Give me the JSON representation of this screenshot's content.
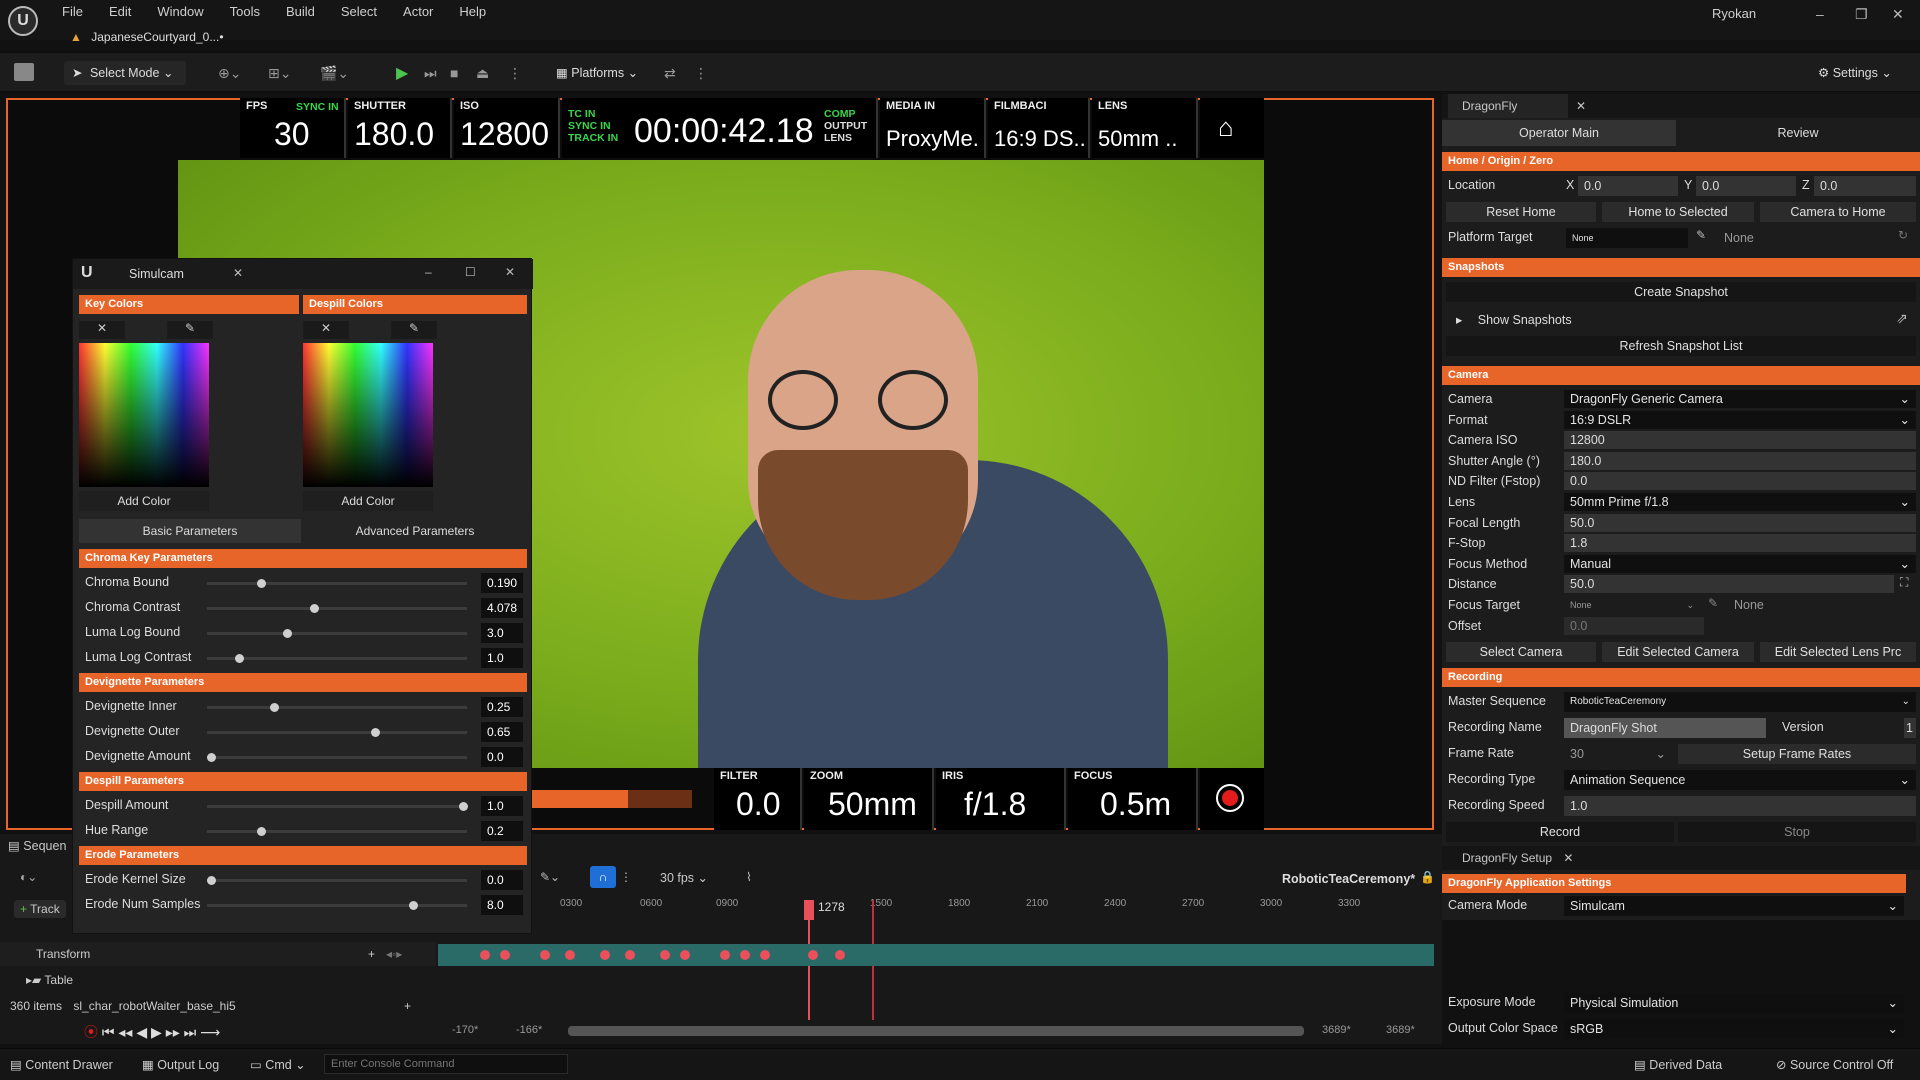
{
  "app": {
    "menu": [
      "File",
      "Edit",
      "Window",
      "Tools",
      "Build",
      "Select",
      "Actor",
      "Help"
    ],
    "document_tab": "JapaneseCourtyard_0...•",
    "user": "Ryokan"
  },
  "toolbar": {
    "select_mode": "Select Mode",
    "platforms": "Platforms",
    "settings": "Settings"
  },
  "hud": {
    "fps_label": "FPS",
    "fps_value": "30",
    "sync_in": "SYNC IN",
    "shutter_label": "SHUTTER",
    "shutter_value": "180.0",
    "iso_label": "ISO",
    "iso_value": "12800",
    "tc_in": "TC IN",
    "tc_sync_in": "SYNC IN",
    "track_in": "TRACK IN",
    "timecode": "00:00:42.18",
    "comp": "COMP",
    "output": "OUTPUT",
    "lens_small": "LENS",
    "media_in_label": "MEDIA IN",
    "media_in_value": "ProxyMe.",
    "filmback_label": "FILMBACI",
    "filmback_value": "16:9 DS..",
    "lens_label": "LENS",
    "lens_value": "50mm ..",
    "filter_label": "FILTER",
    "filter_value": "0.0",
    "zoom_label": "ZOOM",
    "zoom_value": "50mm",
    "iris_label": "IRIS",
    "iris_value": "f/1.8",
    "focus_label": "FOCUS",
    "focus_value": "0.5m"
  },
  "simulcam": {
    "title": "Simulcam",
    "key_colors": "Key Colors",
    "despill_colors": "Despill Colors",
    "add_color": "Add Color",
    "tab_basic": "Basic Parameters",
    "tab_advanced": "Advanced Parameters",
    "sections": [
      {
        "title": "Chroma Key Parameters",
        "params": [
          {
            "label": "Chroma Bound",
            "value": "0.190",
            "pos": 0.2
          },
          {
            "label": "Chroma Contrast",
            "value": "4.078",
            "pos": 0.41
          },
          {
            "label": "Luma Log Bound",
            "value": "3.0",
            "pos": 0.3
          },
          {
            "label": "Luma Log Contrast",
            "value": "1.0",
            "pos": 0.11
          }
        ]
      },
      {
        "title": "Devignette Parameters",
        "params": [
          {
            "label": "Devignette Inner",
            "value": "0.25",
            "pos": 0.25
          },
          {
            "label": "Devignette Outer",
            "value": "0.65",
            "pos": 0.65
          },
          {
            "label": "Devignette Amount",
            "value": "0.0",
            "pos": 0.0
          }
        ]
      },
      {
        "title": "Despill Parameters",
        "params": [
          {
            "label": "Despill Amount",
            "value": "1.0",
            "pos": 1.0
          },
          {
            "label": "Hue Range",
            "value": "0.2",
            "pos": 0.2
          }
        ]
      },
      {
        "title": "Erode Parameters",
        "params": [
          {
            "label": "Erode Kernel Size",
            "value": "0.0",
            "pos": 0.0
          },
          {
            "label": "Erode Num Samples",
            "value": "8.0",
            "pos": 0.8
          }
        ]
      }
    ]
  },
  "panel": {
    "tab": "DragonFly",
    "subtab_main": "Operator Main",
    "subtab_review": "Review",
    "home_section": "Home / Origin / Zero",
    "location_label": "Location",
    "x": "0.0",
    "y": "0.0",
    "z": "0.0",
    "reset_home": "Reset Home",
    "home_to_selected": "Home to Selected",
    "camera_to_home": "Camera to Home",
    "platform_target_label": "Platform Target",
    "platform_target_value": "None",
    "platform_target_value2": "None",
    "snapshots_section": "Snapshots",
    "create_snapshot": "Create Snapshot",
    "show_snapshots": "Show Snapshots",
    "refresh_snapshot": "Refresh Snapshot List",
    "camera_section": "Camera",
    "camera_rows": [
      {
        "label": "Camera",
        "value": "DragonFly Generic Camera",
        "kind": "drop"
      },
      {
        "label": "Format",
        "value": "16:9 DSLR",
        "kind": "drop"
      },
      {
        "label": "Camera ISO",
        "value": "12800",
        "kind": "field"
      },
      {
        "label": "Shutter Angle (°)",
        "value": "180.0",
        "kind": "field"
      },
      {
        "label": "ND Filter (Fstop)",
        "value": "0.0",
        "kind": "field"
      },
      {
        "label": "Lens",
        "value": "50mm Prime f/1.8",
        "kind": "drop"
      },
      {
        "label": "Focal Length",
        "value": "50.0",
        "kind": "field"
      },
      {
        "label": "F-Stop",
        "value": "1.8",
        "kind": "field"
      },
      {
        "label": "Focus Method",
        "value": "Manual",
        "kind": "drop"
      },
      {
        "label": "Distance",
        "value": "50.0",
        "kind": "field"
      },
      {
        "label": "Focus Target",
        "value": "None",
        "kind": "drop"
      },
      {
        "label": "Offset",
        "value": "0.0",
        "kind": "field"
      }
    ],
    "focus_target_value2": "None",
    "select_camera": "Select Camera",
    "edit_selected_camera": "Edit Selected Camera",
    "edit_selected_lens": "Edit Selected Lens Prc",
    "recording_section": "Recording",
    "master_sequence_label": "Master Sequence",
    "master_sequence_value": "RoboticTeaCeremony",
    "recording_name_label": "Recording Name",
    "recording_name_value": "DragonFly Shot",
    "version_label": "Version",
    "version_value": "1",
    "frame_rate_label": "Frame Rate",
    "frame_rate_value": "30",
    "setup_frame_rates": "Setup Frame Rates",
    "recording_type_label": "Recording Type",
    "recording_type_value": "Animation Sequence",
    "recording_speed_label": "Recording Speed",
    "recording_speed_value": "1.0",
    "record": "Record",
    "stop": "Stop",
    "setup_tab": "DragonFly Setup",
    "app_settings_section": "DragonFly Application Settings",
    "camera_mode_label": "Camera Mode",
    "camera_mode_value": "Simulcam",
    "exposure_mode_label": "Exposure Mode",
    "exposure_mode_value": "Physical Simulation",
    "output_color_space_label": "Output Color Space",
    "output_color_space_value": "sRGB"
  },
  "sequencer": {
    "tab": "Sequen",
    "track_btn": "Track",
    "fps": "30 fps",
    "sequence_name": "RoboticTeaCeremony*",
    "playhead": "1278",
    "ticks": [
      "0300",
      "0600",
      "0900",
      "1500",
      "1800",
      "2100",
      "2400",
      "2700",
      "3000",
      "3300"
    ],
    "transform": "Transform",
    "table": "Table",
    "items": "360 items",
    "asset": "sl_char_robotWaiter_base_hi5",
    "range_start": "-170*",
    "range_start2": "-166*",
    "range_end": "3689*",
    "range_end2": "3689*"
  },
  "status": {
    "content_drawer": "Content Drawer",
    "output_log": "Output Log",
    "cmd": "Cmd",
    "console_placeholder": "Enter Console Command",
    "derived_data": "Derived Data",
    "source_control": "Source Control Off"
  },
  "colors": {
    "accent": "#e8652a",
    "record": "#e21b1b",
    "green_hud": "#39d64a"
  }
}
